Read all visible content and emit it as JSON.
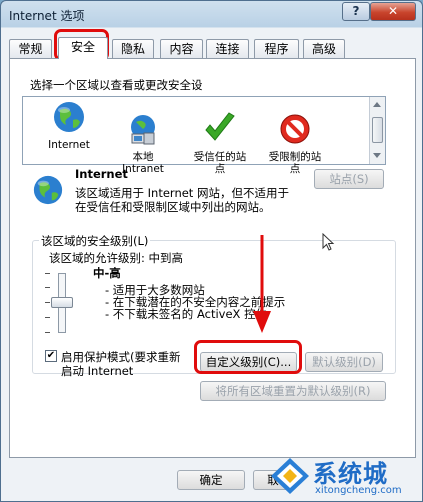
{
  "window": {
    "title": "Internet 选项",
    "help": "?",
    "close": "✕"
  },
  "tabs": [
    "常规",
    "安全",
    "隐私",
    "内容",
    "连接",
    "程序",
    "高级"
  ],
  "zones": {
    "prompt": "选择一个区域以查看或更改安全设",
    "items": [
      {
        "label": "Internet",
        "icon": "globe-icon"
      },
      {
        "label": "本地\nIntranet",
        "icon": "intranet-icon"
      },
      {
        "label": "受信任的站\n点",
        "icon": "checkmark-icon"
      },
      {
        "label": "受限制的站\n点",
        "icon": "no-entry-icon"
      }
    ]
  },
  "zone_info": {
    "name": "Internet",
    "desc_line1": "该区域适用于 Internet 网站，但不适用于",
    "desc_line2": "在受信任和受限制区域中列出的网站。",
    "sites_button": "站点(S)"
  },
  "security_level": {
    "group_label": "该区域的安全级别(L)",
    "allowed_label": "该区域的允许级别: 中到高",
    "level_name": "中-高",
    "bullets": [
      "- 适用于大多数网站",
      "- 在下载潜在的不安全内容之前提示",
      "- 不下载未签名的 ActiveX 控件"
    ],
    "protected_mode_line1": "启用保护模式(要求重新",
    "protected_mode_line2": "启动 Internet",
    "protected_mode_checked": "✔",
    "custom_button": "自定义级别(C)...",
    "default_button": "默认级别(D)",
    "reset_all_button": "将所有区域重置为默认级别(R)"
  },
  "footer": {
    "ok_button": "确定",
    "partial_button": "取"
  },
  "watermark": {
    "brand": "系统城",
    "url": "xitongcheng.com"
  },
  "colors": {
    "highlight": "#e00c0c",
    "accent": "#2a7fd6"
  }
}
